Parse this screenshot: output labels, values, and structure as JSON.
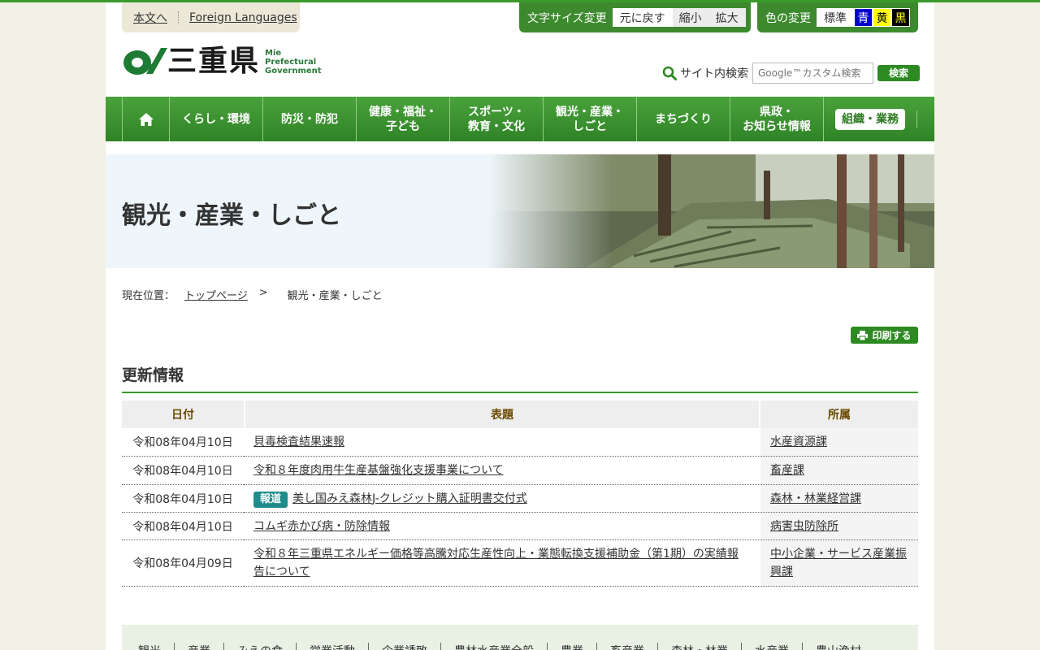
{
  "skip": {
    "main": "本文へ",
    "foreign": "Foreign Languages"
  },
  "fontsize": {
    "label": "文字サイズ変更",
    "reset": "元に戻す",
    "smaller": "縮小",
    "larger": "拡大"
  },
  "colorset": {
    "label": "色の変更",
    "standard": "標準",
    "blue": "青",
    "yellow": "黄",
    "black": "黒"
  },
  "logo": {
    "kanji": "三重県",
    "en1": "Mie",
    "en2": "Prefectural",
    "en3": "Government"
  },
  "search": {
    "label": "サイト内検索",
    "placeholder": "Google™カスタム検索",
    "button": "検索"
  },
  "nav": [
    {
      "l1": "くらし・環境",
      "l2": ""
    },
    {
      "l1": "防災・防犯",
      "l2": ""
    },
    {
      "l1": "健康・福祉・",
      "l2": "子ども"
    },
    {
      "l1": "スポーツ・",
      "l2": "教育・文化"
    },
    {
      "l1": "観光・産業・",
      "l2": "しごと"
    },
    {
      "l1": "まちづくり",
      "l2": ""
    },
    {
      "l1": "県政・",
      "l2": "お知らせ情報"
    },
    {
      "l1": "組織・業務",
      "l2": ""
    }
  ],
  "hero": {
    "title": "観光・産業・しごと"
  },
  "breadcrumb": {
    "label": "現在位置：",
    "home": "トップページ",
    "sep": ">",
    "current": "観光・産業・しごと"
  },
  "print": "印刷する",
  "section": {
    "title": "更新情報"
  },
  "table": {
    "headers": {
      "date": "日付",
      "title": "表題",
      "dept": "所属"
    },
    "rows": [
      {
        "date": "令和08年04月10日",
        "badge": "",
        "title": "貝毒検査結果速報",
        "dept": "水産資源課"
      },
      {
        "date": "令和08年04月10日",
        "badge": "",
        "title": "令和８年度肉用牛生産基盤強化支援事業について",
        "dept": "畜産課"
      },
      {
        "date": "令和08年04月10日",
        "badge": "報道",
        "title": "美し国みえ森林J-クレジット購入証明書交付式",
        "dept": "森林・林業経営課"
      },
      {
        "date": "令和08年04月10日",
        "badge": "",
        "title": "コムギ赤かび病・防除情報",
        "dept": "病害虫防除所"
      },
      {
        "date": "令和08年04月09日",
        "badge": "",
        "title": "令和８年三重県エネルギー価格等高騰対応生産性向上・業態転換支援補助金（第1期）の実績報告について",
        "dept": "中小企業・サービス産業振興課"
      }
    ]
  },
  "footer_nav": [
    "観光",
    "産業",
    "みえの食",
    "営業活動",
    "企業誘致",
    "農林水産業全般",
    "農業",
    "畜産業",
    "森林・林業",
    "水産業",
    "農山漁村"
  ]
}
